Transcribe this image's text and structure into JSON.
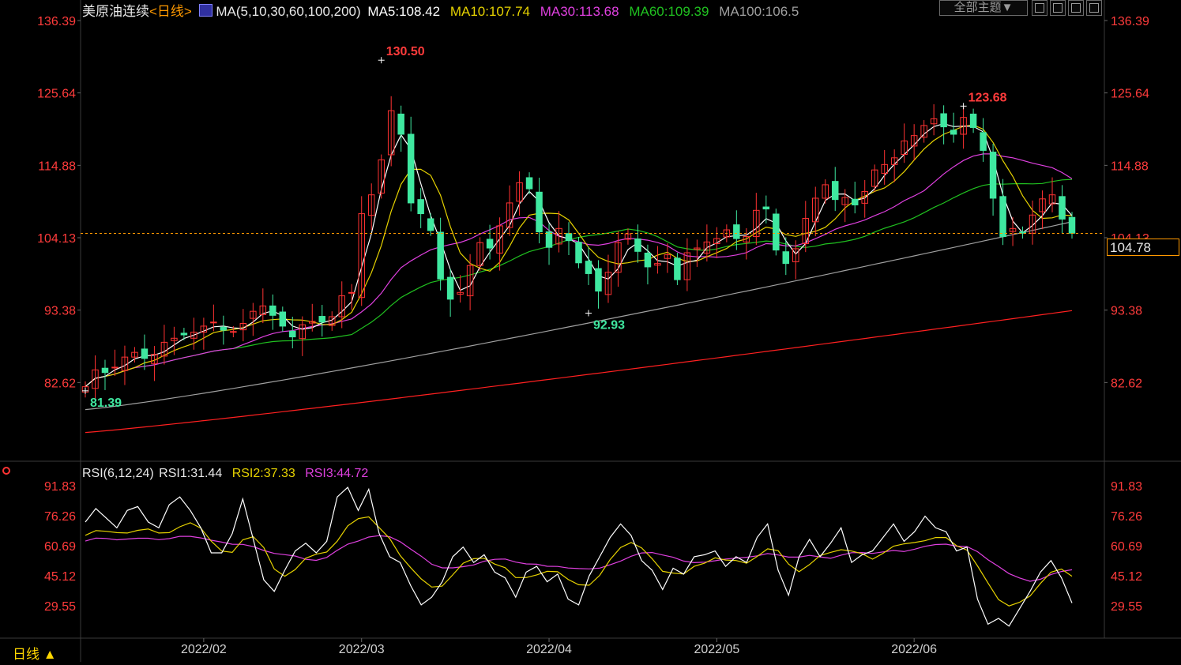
{
  "header": {
    "title": "美原油连续",
    "period": "<日线>",
    "ma_label": "MA(5,10,30,60,100,200)",
    "ma5": "MA5:108.42",
    "ma10": "MA10:107.74",
    "ma30": "MA30:113.68",
    "ma60": "MA60:109.39",
    "ma100": "MA100:106.5",
    "theme_button": "全部主题▼"
  },
  "rsi_header": {
    "label": "RSI(6,12,24)",
    "rsi1": "RSI1:31.44",
    "rsi2": "RSI2:37.33",
    "rsi3": "RSI3:44.72"
  },
  "bottom": {
    "period_tab": "日线 ▲"
  },
  "colors": {
    "up": "#ff3232",
    "down": "#3fe8a0",
    "ma5": "#ffffff",
    "ma10": "#e6d200",
    "ma30": "#e040e0",
    "ma60": "#20c020",
    "ma100": "#a0a0a0",
    "ma200": "#ff2020",
    "axis_text": "#ff3b3b",
    "grid": "#2a2a2a"
  },
  "last_price": "104.78",
  "chart_data": {
    "type": "candlestick",
    "price_axis": {
      "ticks": [
        "136.39",
        "125.64",
        "114.88",
        "104.13",
        "93.38",
        "82.62"
      ],
      "ylim": [
        75.0,
        136.39
      ]
    },
    "rsi_axis": {
      "ticks": [
        "91.83",
        "76.26",
        "60.69",
        "45.12",
        "29.55"
      ],
      "ylim": [
        20,
        92
      ]
    },
    "x_labels": [
      "2022/02",
      "2022/03",
      "2022/04",
      "2022/05",
      "2022/06"
    ],
    "x_label_index": [
      12,
      28,
      47,
      64,
      84
    ],
    "annotations": [
      {
        "text": "130.50",
        "index": 30,
        "value": 130.5,
        "type": "high"
      },
      {
        "text": "92.93",
        "index": 51,
        "value": 92.93,
        "type": "low"
      },
      {
        "text": "123.68",
        "index": 89,
        "value": 123.68,
        "type": "high"
      },
      {
        "text": "81.39",
        "index": 0,
        "value": 81.39,
        "type": "low"
      }
    ],
    "reference_line": 104.78,
    "closes": [
      82.0,
      84.5,
      84.1,
      84.9,
      86.4,
      87.1,
      86.2,
      86.8,
      88.6,
      89.2,
      89.7,
      90.1,
      91.0,
      91.6,
      90.4,
      90.2,
      91.4,
      93.2,
      94.0,
      92.6,
      91.0,
      89.4,
      91.2,
      91.7,
      91.6,
      92.4,
      95.5,
      96.0,
      107.7,
      110.5,
      115.7,
      123.0,
      119.5,
      109.3,
      107.7,
      105.2,
      98.0,
      95.0,
      96.0,
      100.0,
      103.4,
      102.6,
      105.9,
      109.3,
      112.3,
      111.4,
      105.0,
      102.7,
      105.5,
      103.7,
      100.4,
      98.8,
      96.2,
      99.0,
      103.4,
      104.7,
      102.1,
      99.8,
      100.3,
      101.6,
      97.9,
      101.9,
      102.6,
      103.5,
      104.0,
      105.3,
      104.0,
      104.3,
      108.2,
      108.4,
      102.3,
      100.3,
      102.5,
      107.0,
      110.0,
      112.0,
      109.8,
      110.1,
      109.0,
      111.0,
      114.2,
      115.0,
      116.0,
      118.5,
      119.3,
      120.8,
      121.8,
      120.6,
      119.5,
      122.0,
      120.5,
      117.1,
      110.0,
      104.3,
      105.5,
      104.8,
      107.5,
      109.9,
      110.5,
      106.9,
      104.8
    ],
    "rsi1": [
      73,
      80,
      75,
      70,
      79,
      81,
      73,
      70,
      82,
      86,
      79,
      70,
      57,
      57,
      67,
      85,
      64,
      43,
      37,
      48,
      58,
      62,
      57,
      63,
      86,
      91,
      79,
      90,
      67,
      55,
      52,
      40,
      30,
      34,
      42,
      55,
      60,
      52,
      56,
      47,
      44,
      34,
      47,
      50,
      42,
      46,
      33,
      30,
      45,
      55,
      65,
      72,
      66,
      53,
      48,
      38,
      49,
      46,
      55,
      56,
      58,
      50,
      55,
      52,
      65,
      72,
      48,
      35,
      55,
      64,
      55,
      62,
      70,
      52,
      56,
      58,
      65,
      72,
      63,
      68,
      76,
      70,
      68,
      58,
      60,
      33,
      20,
      23,
      19,
      28,
      37,
      47,
      53,
      44,
      31
    ]
  }
}
